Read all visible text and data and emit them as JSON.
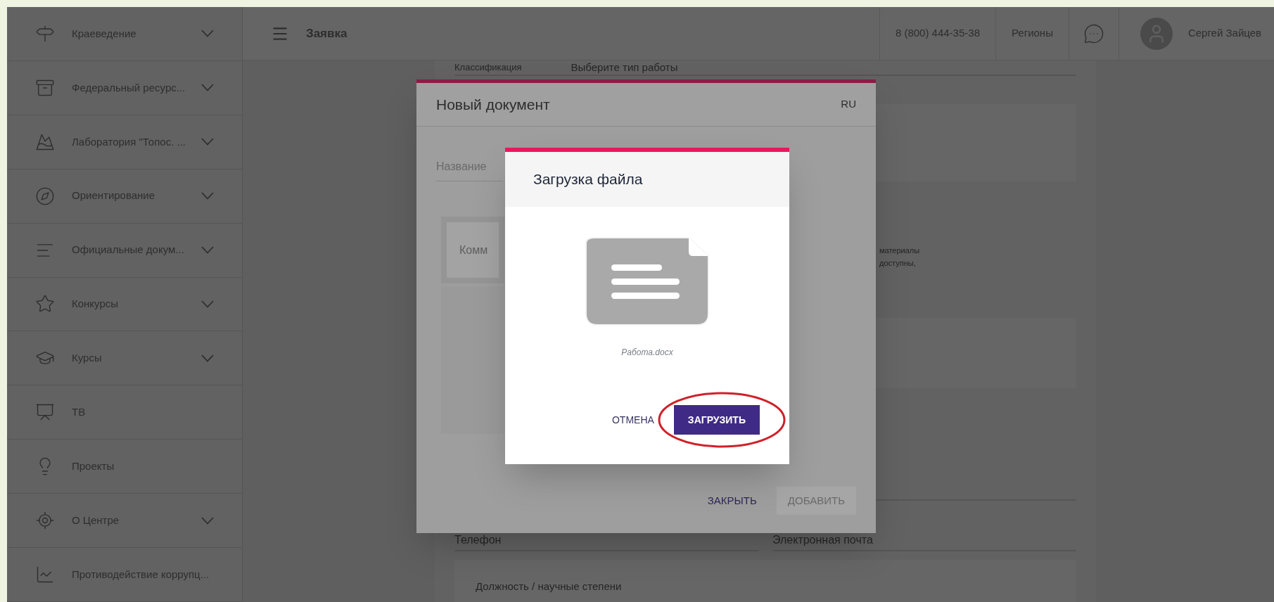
{
  "sidebar": {
    "items": [
      {
        "label": "Краеведение",
        "kind": "signpost",
        "expandable": true
      },
      {
        "label": "Федеральный ресурс...",
        "kind": "archive",
        "expandable": true
      },
      {
        "label": "Лаборатория \"Топос. ...",
        "kind": "mountain",
        "expandable": true
      },
      {
        "label": "Ориентирование",
        "kind": "compass",
        "expandable": true
      },
      {
        "label": "Официальные докум...",
        "kind": "lines",
        "expandable": true
      },
      {
        "label": "Конкурсы",
        "kind": "star",
        "expandable": true
      },
      {
        "label": "Курсы",
        "kind": "cap",
        "expandable": true
      },
      {
        "label": "ТВ",
        "kind": "screen",
        "expandable": false
      },
      {
        "label": "Проекты",
        "kind": "bulb",
        "expandable": false
      },
      {
        "label": "О Центре",
        "kind": "compass_rose",
        "expandable": true
      },
      {
        "label": "Противодействие коррупц...",
        "kind": "chart",
        "expandable": false
      }
    ]
  },
  "topbar": {
    "title": "Заявка",
    "phone": "8 (800) 444-35-38",
    "regions": "Регионы",
    "user": "Сергей Зайцев"
  },
  "background_form": {
    "classification_label": "Классификация",
    "classification_placeholder": "Выберите тип работы",
    "note_lines": [
      "материалы",
      "доступны,"
    ],
    "phone_label": "Телефон",
    "email_label": "Электронная почта",
    "position_label": "Должность / научные степени"
  },
  "document_dialog": {
    "title": "Новый документ",
    "language": "RU",
    "name_placeholder": "Название",
    "comment_placeholder": "Комм",
    "buttons": [
      {
        "label": "ЗАКРЫТЬ",
        "disabled": false
      },
      {
        "label": "ДОБАВИТЬ",
        "disabled": true
      }
    ]
  },
  "upload_dialog": {
    "title": "Загрузка файла",
    "file_name": "Работа.docx",
    "buttons": [
      {
        "label": "ОТМЕНА",
        "kind": "text",
        "highlighted": false
      },
      {
        "label": "ЗАГРУЗИТЬ",
        "kind": "primary",
        "highlighted": true
      }
    ]
  }
}
